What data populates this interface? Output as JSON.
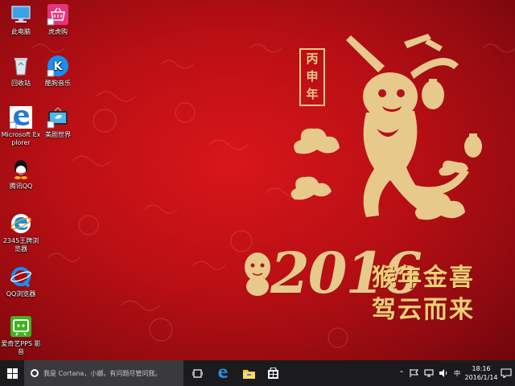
{
  "desktop": {
    "icons": [
      {
        "label": "此电脑",
        "icon": "computer-icon"
      },
      {
        "label": "虎虎购",
        "icon": "shopping-basket-icon"
      },
      {
        "label": "回收站",
        "icon": "recycle-bin-icon"
      },
      {
        "label": "酷狗音乐",
        "icon": "kugou-music-icon"
      },
      {
        "label": "Microsoft Explorer",
        "icon": "edge-icon"
      },
      {
        "label": "美剧世界",
        "icon": "tv-twitter-icon"
      },
      {
        "label": "腾讯QQ",
        "icon": "qq-penguin-icon"
      },
      {
        "label": "2345王牌浏览器",
        "icon": "browser-2345-icon"
      },
      {
        "label": "QQ浏览器",
        "icon": "qq-browser-icon"
      },
      {
        "label": "爱奇艺PPS 影音",
        "icon": "iqiyi-pps-icon"
      }
    ]
  },
  "wallpaper": {
    "stamp": "丙申年",
    "year": "2016",
    "blessing_line1": "猴年金喜",
    "blessing_line2": "驾云而来",
    "colors": {
      "background": "#c3121a",
      "gold": "#e7c98c"
    }
  },
  "taskbar": {
    "search_placeholder": "我是 Cortana，小娜。有问题尽管问我。",
    "pinned": [
      "task-view-icon",
      "edge-icon",
      "file-explorer-icon",
      "store-icon"
    ],
    "tray": {
      "ime": "中",
      "time": "18:16",
      "date": "2016/1/14"
    }
  }
}
